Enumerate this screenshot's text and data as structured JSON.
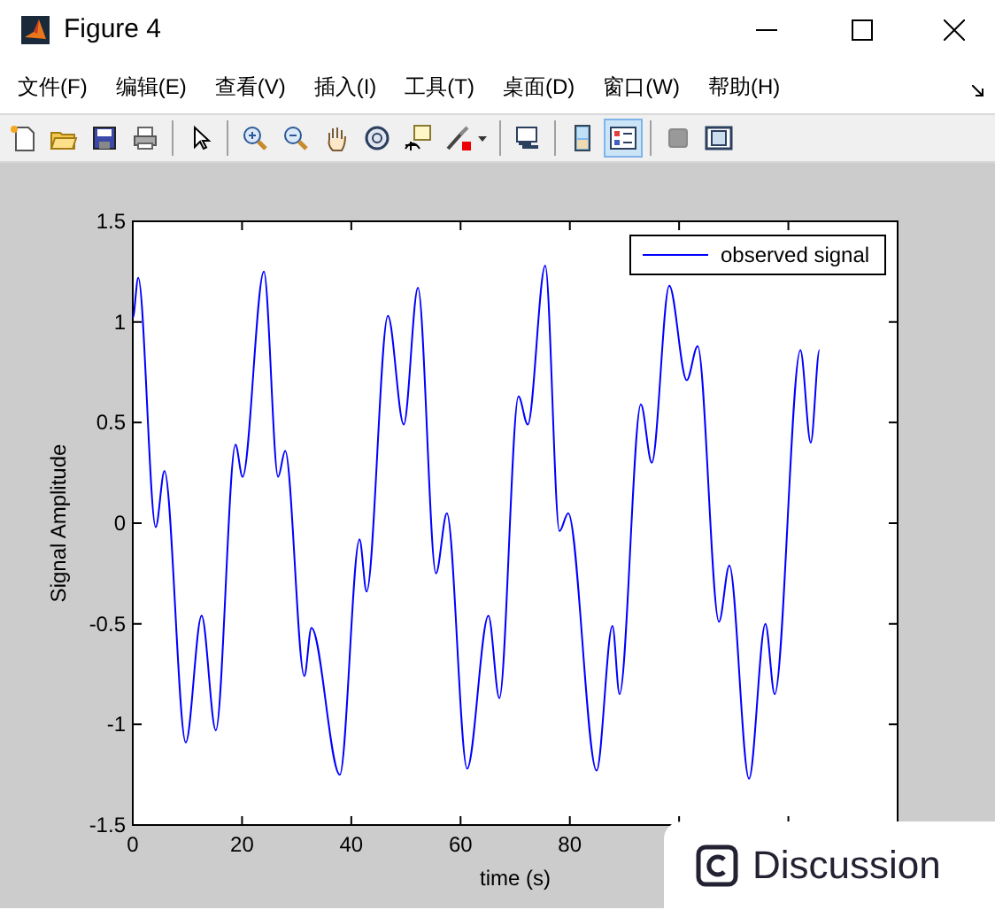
{
  "window": {
    "title": "Figure 4"
  },
  "menu": [
    {
      "label": "文件(F)"
    },
    {
      "label": "编辑(E)"
    },
    {
      "label": "查看(V)"
    },
    {
      "label": "插入(I)"
    },
    {
      "label": "工具(T)"
    },
    {
      "label": "桌面(D)"
    },
    {
      "label": "窗口(W)"
    },
    {
      "label": "帮助(H)"
    }
  ],
  "toolbar": [
    {
      "kind": "new",
      "selected": false
    },
    {
      "kind": "open",
      "selected": false
    },
    {
      "kind": "save",
      "selected": false
    },
    {
      "kind": "print",
      "selected": false
    },
    {
      "kind": "sep"
    },
    {
      "kind": "pointer",
      "selected": false
    },
    {
      "kind": "sep"
    },
    {
      "kind": "zoomin",
      "selected": false
    },
    {
      "kind": "zoomout",
      "selected": false
    },
    {
      "kind": "pan",
      "selected": false
    },
    {
      "kind": "rotate",
      "selected": false
    },
    {
      "kind": "datacursor",
      "selected": false
    },
    {
      "kind": "brush",
      "selected": false
    },
    {
      "kind": "sep"
    },
    {
      "kind": "link",
      "selected": false
    },
    {
      "kind": "sep"
    },
    {
      "kind": "colorbar",
      "selected": false
    },
    {
      "kind": "legend",
      "selected": true
    },
    {
      "kind": "sep"
    },
    {
      "kind": "hidetools",
      "selected": false
    },
    {
      "kind": "showtools",
      "selected": false
    }
  ],
  "axes": {
    "chart_data": {
      "type": "line",
      "xlabel": "time (s)",
      "ylabel": "Signal Amplitude",
      "xlim": [
        0,
        140
      ],
      "ylim": [
        -1.5,
        1.5
      ],
      "xticks": [
        0,
        20,
        40,
        60,
        80
      ],
      "yticks": [
        -1.5,
        -1,
        -0.5,
        0,
        0.5,
        1,
        1.5
      ],
      "x": [
        0,
        1,
        4.2,
        5.8,
        9.7,
        12.6,
        15.2,
        18.8,
        20.1,
        24,
        26.6,
        27.9,
        31.4,
        32.7,
        37.9,
        41.5,
        42.8,
        46.7,
        49.6,
        52.2,
        55.5,
        57.5,
        61.2,
        65.1,
        67.1,
        70.6,
        72.3,
        75.5,
        78.1,
        79.7,
        84.9,
        87.8,
        89.1,
        93,
        95,
        98.2,
        101.4,
        103.4,
        107.3,
        109.2,
        112.8,
        115.8,
        117.5,
        122.2,
        124.1,
        125.7
      ],
      "series": [
        {
          "name": "observed signal",
          "color": "#0000ff",
          "values": [
            1.02,
            1.22,
            -0.02,
            0.26,
            -1.09,
            -0.46,
            -1.03,
            0.39,
            0.23,
            1.25,
            0.23,
            0.36,
            -0.76,
            -0.52,
            -1.25,
            -0.08,
            -0.34,
            1.03,
            0.49,
            1.17,
            -0.25,
            0.05,
            -1.22,
            -0.46,
            -0.87,
            0.63,
            0.49,
            1.28,
            -0.04,
            0.05,
            -1.23,
            -0.51,
            -0.85,
            0.59,
            0.3,
            1.18,
            0.71,
            0.88,
            -0.49,
            -0.21,
            -1.27,
            -0.5,
            -0.85,
            0.86,
            0.4,
            0.86
          ]
        }
      ]
    }
  },
  "overlay_button": {
    "label": "Discussion"
  }
}
